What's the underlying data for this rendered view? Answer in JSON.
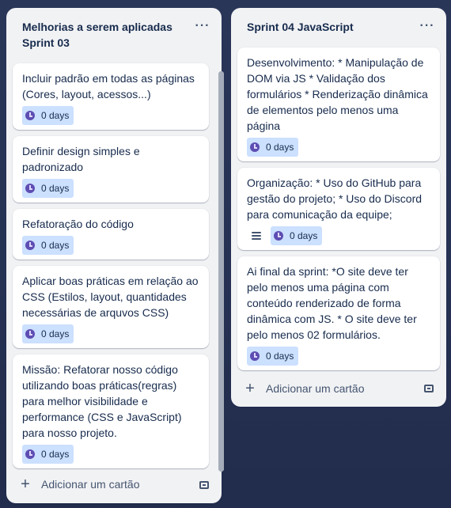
{
  "lists": [
    {
      "title": "Melhorias a serem aplicadas Sprint 03",
      "menu": "···",
      "add_card": "Adicionar um cartão",
      "cards": [
        {
          "text": "Incluir padrão em todas as páginas (Cores, layout, acessos...)",
          "badge": "0 days"
        },
        {
          "text": "Definir design simples e padronizado",
          "badge": "0 days"
        },
        {
          "text": "Refatoração do código",
          "badge": "0 days"
        },
        {
          "text": "Aplicar boas práticas em relação ao CSS (Estilos, layout, quantidades necessárias de arquvos CSS)",
          "badge": "0 days"
        },
        {
          "text": "Missão: Refatorar nosso código utilizando boas práticas(regras) para melhor visibilidade e performance (CSS e JavaScript)\npara nosso projeto.",
          "badge": "0 days"
        }
      ]
    },
    {
      "title": "Sprint 04 JavaScript",
      "menu": "···",
      "add_card": "Adicionar um cartão",
      "cards": [
        {
          "text": "Desenvolvimento: * Manipulação de DOM via JS * Validação dos formulários * Renderização dinâmica de elementos pelo menos uma página",
          "badge": "0 days"
        },
        {
          "text": "Organização: * Uso do GitHub para gestão do projeto; * Uso do Discord para comunicação da equipe;",
          "badge": "0 days",
          "has_description": true
        },
        {
          "text": "Ai final da sprint: *O site deve ter pelo menos uma página com conteúdo renderizado de forma dinâmica com JS. * O site deve ter pelo menos 02 formulários.",
          "badge": "0 days"
        }
      ]
    }
  ],
  "icons": {
    "badge": "clock-icon",
    "description": "description-lines-icon",
    "add": "plus-icon",
    "template": "card-template-icon",
    "menu": "more-horizontal-icon"
  },
  "colors": {
    "badge_bg": "#cce0ff",
    "badge_icon": "#5e4db2",
    "list_bg": "#f1f2f4",
    "board_bg": "#263254"
  }
}
